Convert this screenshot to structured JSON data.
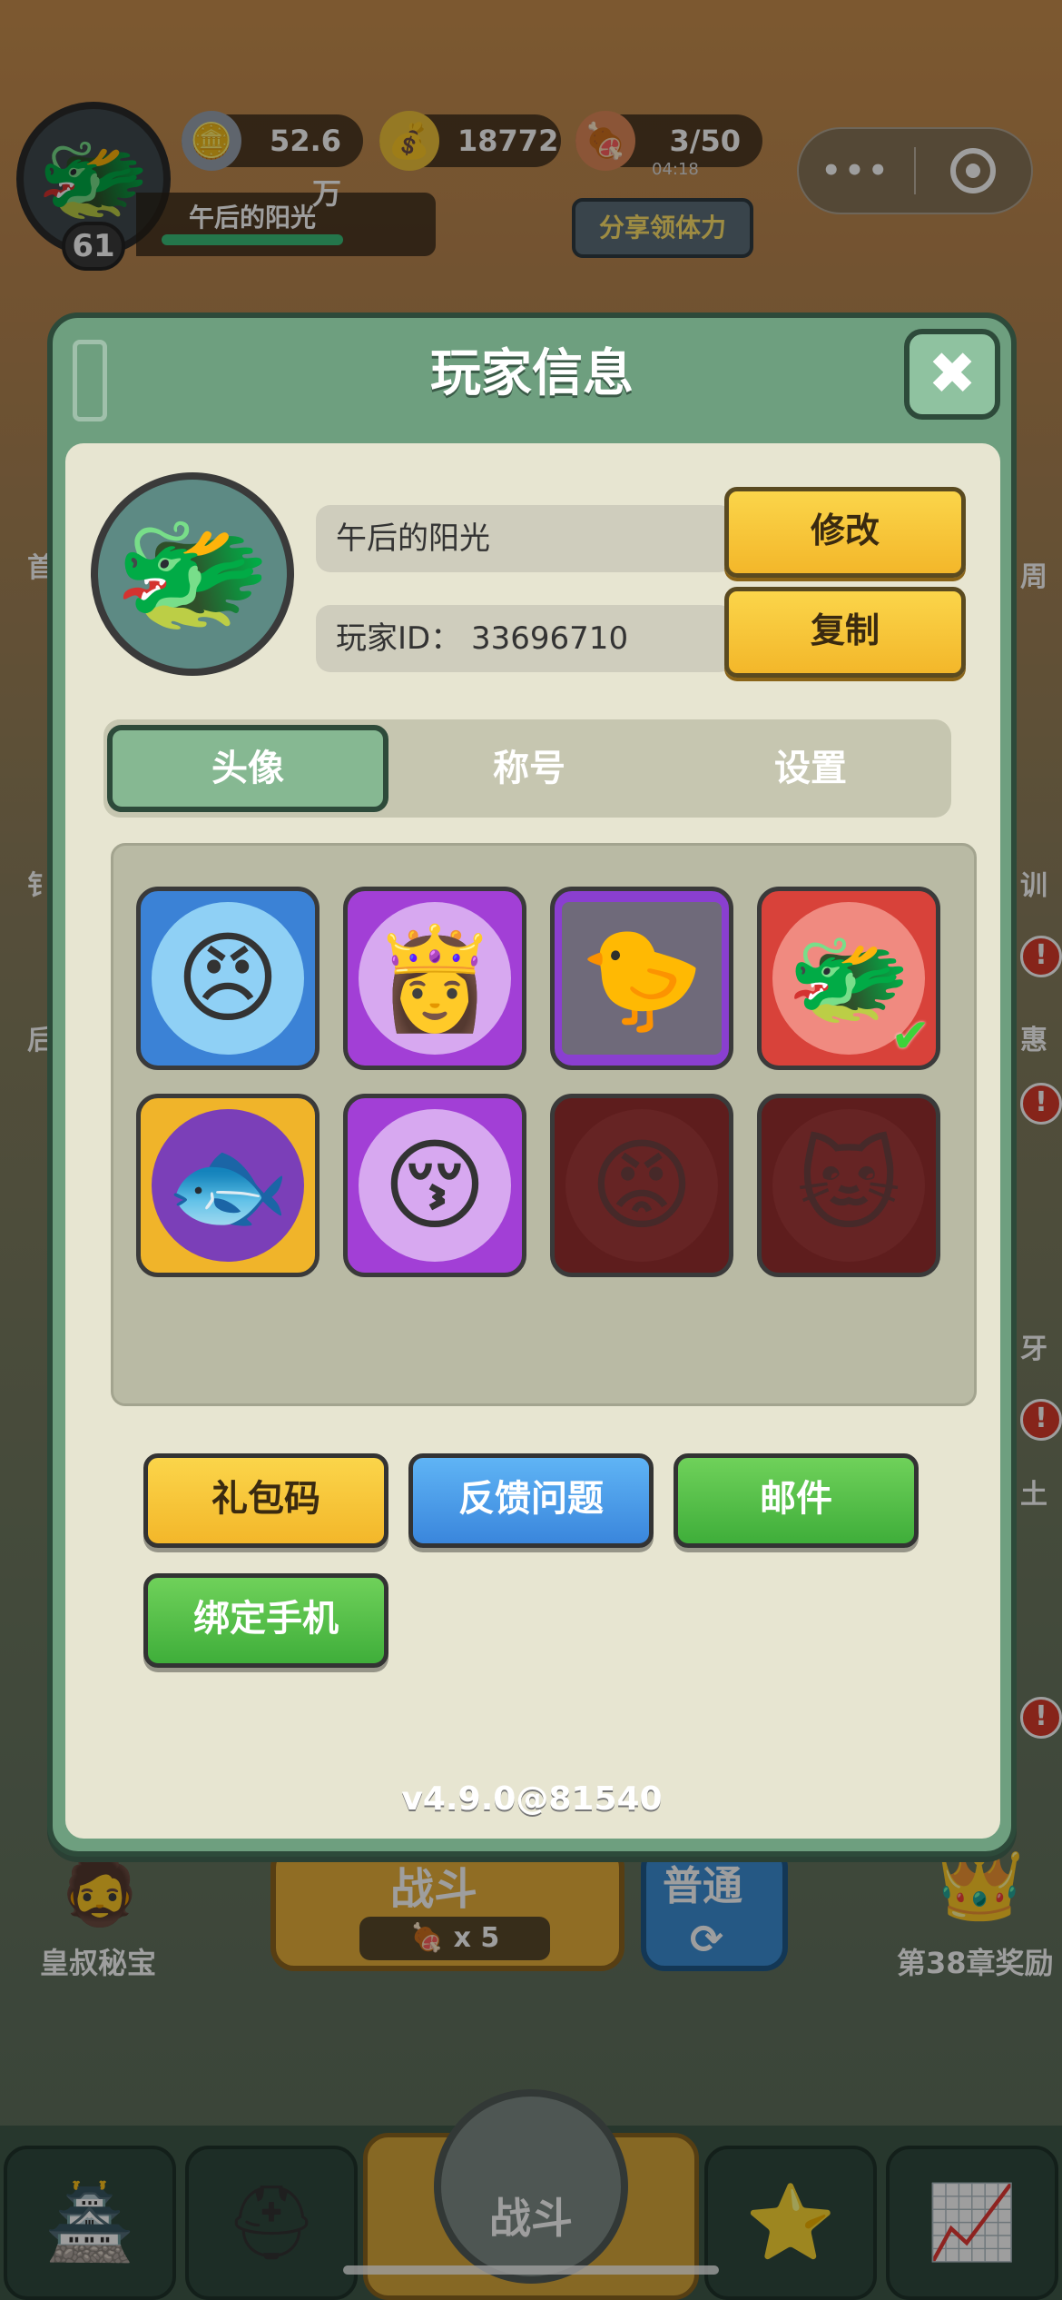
{
  "hud": {
    "player_name": "午后的阳光",
    "level": "61",
    "silver": "52.6万",
    "gold": "18772",
    "stamina": "3/50",
    "stamina_timer": "04:18",
    "share_label": "分享领体力",
    "capsule_more": "•••",
    "avatar_icon": "dragon-helmet-avatar-icon"
  },
  "panel": {
    "title": "玩家信息",
    "player_name": "午后的阳光",
    "player_id": "玩家ID： 33696710",
    "modify_label": "修改",
    "copy_label": "复制",
    "tabs": [
      {
        "label": "头像",
        "active": true
      },
      {
        "label": "称号",
        "active": false
      },
      {
        "label": "设置",
        "active": false
      }
    ],
    "avatars": [
      {
        "icon": "warrior-headband-icon",
        "glyph": "😠",
        "frame": "#3b82d6",
        "inner": "#8fd0f5",
        "locked": false,
        "selected": false
      },
      {
        "icon": "purple-hair-hero-icon",
        "glyph": "👸",
        "frame": "#a23fd6",
        "inner": "#d7a8f0",
        "locked": false,
        "selected": false
      },
      {
        "icon": "photo-avatar-icon",
        "glyph": "🐤",
        "frame": "#8a3fd0",
        "inner": "#6f6a7a",
        "locked": false,
        "selected": false
      },
      {
        "icon": "dragon-helmet-avatar-icon",
        "glyph": "🐲",
        "frame": "#d8423a",
        "inner": "#f08a80",
        "locked": false,
        "selected": true
      },
      {
        "icon": "red-fish-icon",
        "glyph": "🐟",
        "frame": "#f0b42a",
        "inner": "#7b3fb8",
        "locked": false,
        "selected": false
      },
      {
        "icon": "green-hat-hero-icon",
        "glyph": "😚",
        "frame": "#a23fd6",
        "inner": "#d7a8f0",
        "locked": false,
        "selected": false
      },
      {
        "icon": "warlord-locked-icon",
        "glyph": "😡",
        "frame": "#5e1d1d",
        "inner": "#6e2a2a",
        "locked": true,
        "selected": false
      },
      {
        "icon": "lucky-cat-locked-icon",
        "glyph": "🐱",
        "frame": "#5e1d1d",
        "inner": "#6e2a2a",
        "locked": true,
        "selected": false
      }
    ],
    "buttons": {
      "gift_code": "礼包码",
      "feedback": "反馈问题",
      "mail": "邮件",
      "bind_phone": "绑定手机"
    },
    "version": "v4.9.0@81540"
  },
  "background": {
    "battle_label": "战斗",
    "battle_cost": "x 5",
    "mode_label": "普通",
    "left_event": "皇叔秘宝",
    "right_event": "第38章奖励",
    "nav_fight": "战斗",
    "side_left": [
      "首",
      "钅",
      "后"
    ],
    "side_right": [
      "周",
      "训",
      "惠",
      "牙",
      "土"
    ]
  },
  "colors": {
    "panel_green": "#6e9f7f",
    "yellow_btn": "#f3b72a",
    "blue_btn": "#3f8fe0",
    "green_btn": "#3fae3a"
  }
}
